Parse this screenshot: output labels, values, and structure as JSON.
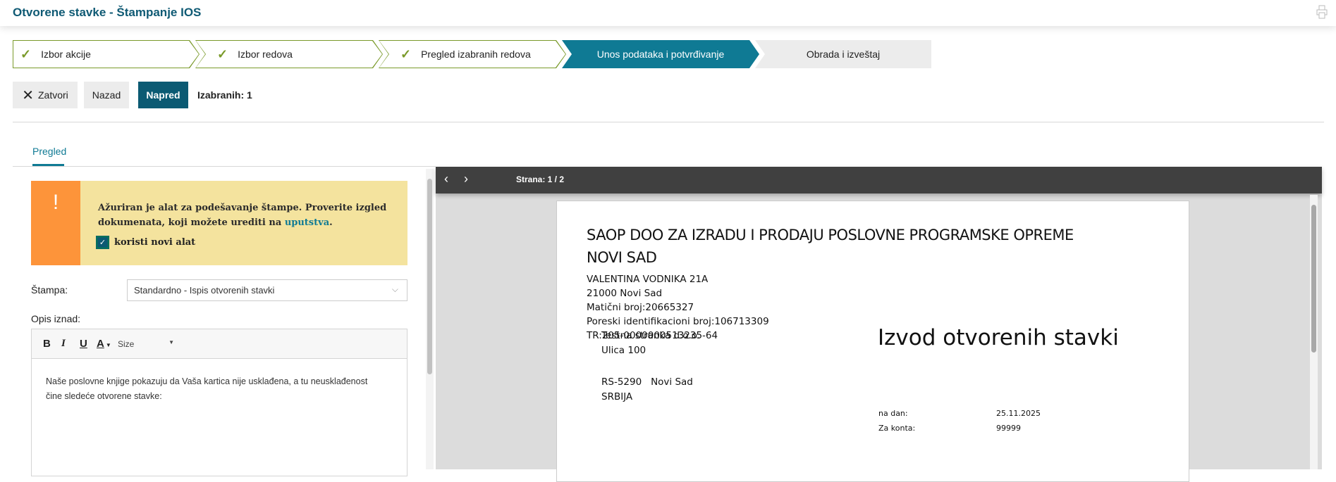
{
  "header": {
    "title": "Otvorene stavke - Štampanje IOS",
    "print_icon": "printer-icon"
  },
  "steps": [
    {
      "label": "Izbor akcije",
      "state": "done"
    },
    {
      "label": "Izbor redova",
      "state": "done"
    },
    {
      "label": "Pregled izabranih redova",
      "state": "done"
    },
    {
      "label": "Unos podataka i potvrđivanje",
      "state": "active"
    },
    {
      "label": "Obrada i izveštaj",
      "state": "pending"
    }
  ],
  "toolbar": {
    "close": "Zatvori",
    "back": "Nazad",
    "next": "Napred",
    "selected": "Izabranih: 1"
  },
  "tabs": [
    {
      "label": "Pregled",
      "active": true
    }
  ],
  "notice": {
    "line1": "Ažuriran je alat za podešavanje štampe. Proverite izgled",
    "line2_prefix": "dokumenata, koji možete urediti na ",
    "link": "uputstva",
    "line2_suffix": ".",
    "checkbox_label": "koristi novi alat",
    "checked": true
  },
  "form": {
    "stampa_label": "Štampa:",
    "stampa_value": "Standardno - Ispis otvorenih stavki",
    "opis_label": "Opis iznad:"
  },
  "editor": {
    "bold": "B",
    "italic": "I",
    "underline": "U",
    "color": "A",
    "size": "Size",
    "line1": "Naše poslovne knjige pokazuju da Vaša kartica nije usklađena, a tu neusklađenost",
    "line2": "čine sledeće otvorene stavke:"
  },
  "viewer": {
    "page": "Strana: 1 / 2"
  },
  "document": {
    "company1": "SAOP DOO ZA IZRADU I PRODAJU POSLOVNE PROGRAMSKE OPREME",
    "company2": "NOVI SAD",
    "address": "VALENTINA VODNIKA 21A",
    "city": "21000 Novi Sad",
    "mb": "Matični broj:20665327",
    "pib": "Poreski identifikacioni broj:106713309",
    "tr": "TR:205-0000000513235-64",
    "partner_name": "Testna stranka d.o.o.",
    "partner_street": "Ulica 100",
    "partner_post": "RS-5290",
    "partner_city": "Novi Sad",
    "partner_country": "SRBIJA",
    "doc_title": "Izvod otvorenih stavki",
    "na_dan_label": "na dan:",
    "na_dan": "25.11.2025",
    "konto_label": "Za konta:",
    "konto": "99999"
  },
  "colors": {
    "primary": "#0b5a73",
    "accent": "#0f7a94",
    "check": "#7a9a2a",
    "warning_bg": "#f4e39e",
    "warning_side": "#fd943a"
  }
}
